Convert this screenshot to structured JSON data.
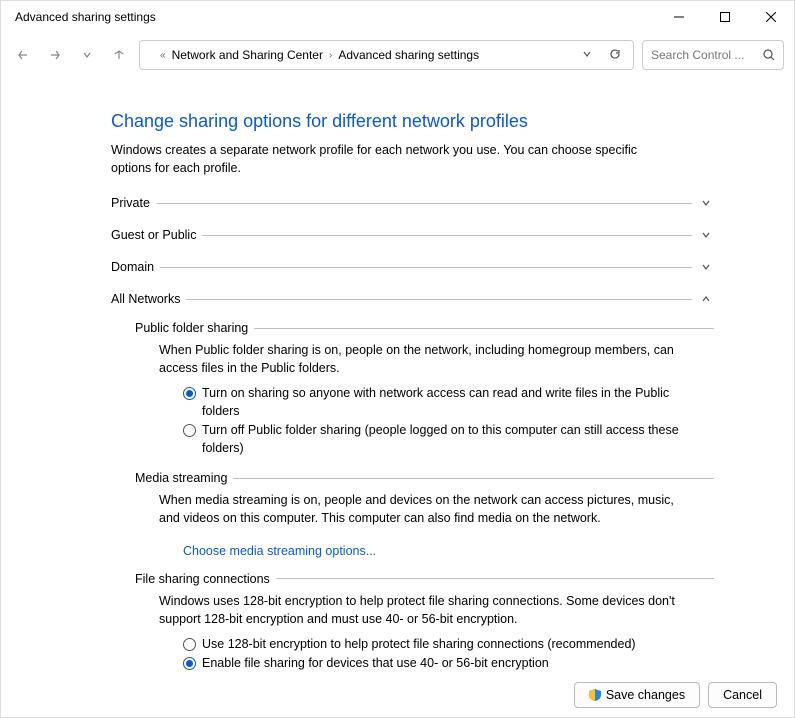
{
  "window": {
    "title": "Advanced sharing settings"
  },
  "breadcrumb": {
    "item1": "Network and Sharing Center",
    "item2": "Advanced sharing settings"
  },
  "search": {
    "placeholder": "Search Control ..."
  },
  "page": {
    "title": "Change sharing options for different network profiles",
    "description": "Windows creates a separate network profile for each network you use. You can choose specific options for each profile."
  },
  "sections": {
    "private": {
      "label": "Private"
    },
    "guest": {
      "label": "Guest or Public"
    },
    "domain": {
      "label": "Domain"
    },
    "all": {
      "label": "All Networks"
    }
  },
  "publicFolder": {
    "label": "Public folder sharing",
    "body": "When Public folder sharing is on, people on the network, including homegroup members, can access files in the Public folders.",
    "opt1": "Turn on sharing so anyone with network access can read and write files in the Public folders",
    "opt2": "Turn off Public folder sharing (people logged on to this computer can still access these folders)"
  },
  "mediaStreaming": {
    "label": "Media streaming",
    "body": "When media streaming is on, people and devices on the network can access pictures, music, and videos on this computer. This computer can also find media on the network.",
    "link": "Choose media streaming options..."
  },
  "fileSharing": {
    "label": "File sharing connections",
    "body": "Windows uses 128-bit encryption to help protect file sharing connections. Some devices don't support 128-bit encryption and must use 40- or 56-bit encryption.",
    "opt1": "Use 128-bit encryption to help protect file sharing connections (recommended)",
    "opt2": "Enable file sharing for devices that use 40- or 56-bit encryption"
  },
  "footer": {
    "save": "Save changes",
    "cancel": "Cancel"
  }
}
